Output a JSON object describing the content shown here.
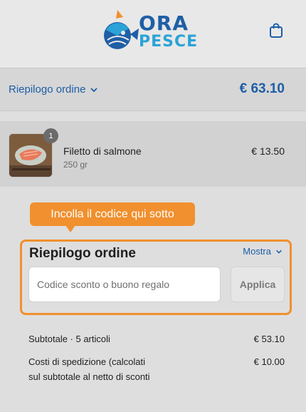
{
  "brand": {
    "line1": "ORA",
    "line2": "PESCE"
  },
  "icons": {
    "cart": "shopping-bag-icon",
    "chevron": "chevron-down-icon",
    "logo": "fish-logo-icon"
  },
  "colors": {
    "accent": "#1d5ea8",
    "highlight": "#f0902e"
  },
  "summary": {
    "toggle_label": "Riepilogo ordine",
    "total": "€ 63.10"
  },
  "product": {
    "quantity_badge": "1",
    "name": "Filetto di salmone",
    "variant": "250 gr",
    "price": "€ 13.50"
  },
  "tooltip": {
    "text": "Incolla il codice qui sotto"
  },
  "discount": {
    "title": "Riepilogo ordine",
    "show_label": "Mostra",
    "input_placeholder": "Codice sconto o buono regalo",
    "apply_label": "Applica"
  },
  "totals": {
    "subtotal_label": "Subtotale · 5 articoli",
    "subtotal_value": "€ 53.10",
    "shipping_label_line1": "Costi di spedizione (calcolati",
    "shipping_label_line2": "sul subtotale al netto di sconti",
    "shipping_value": "€ 10.00"
  }
}
